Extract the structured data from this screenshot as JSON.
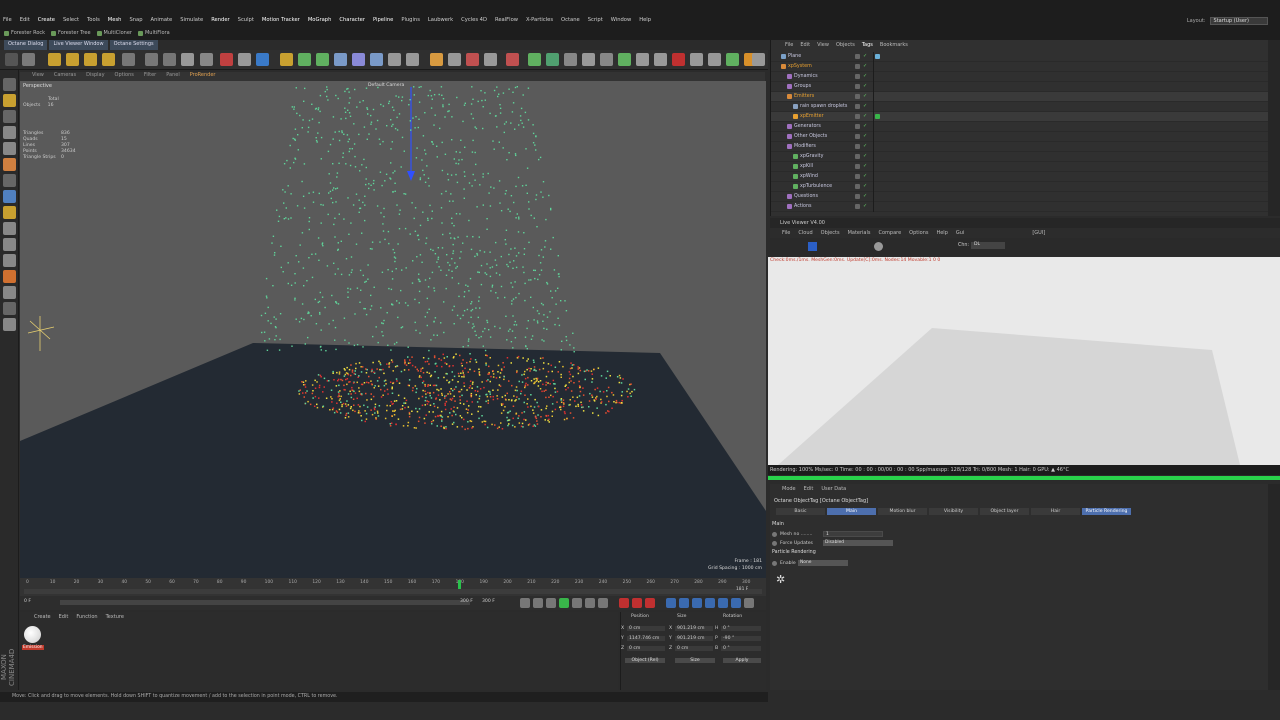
{
  "menubar": {
    "items": [
      "File",
      "Edit",
      "Create",
      "Select",
      "Tools",
      "Mesh",
      "Snap",
      "Animate",
      "Simulate",
      "Render",
      "Sculpt",
      "Motion Tracker",
      "MoGraph",
      "Character",
      "Pipeline",
      "Plugins",
      "Laubwerk",
      "Cycles 4D",
      "RealFlow",
      "X-Particles",
      "Octane",
      "Script",
      "Window",
      "Help"
    ],
    "layout_label": "Layout:",
    "layout_value": "Startup (User)"
  },
  "plugbar": {
    "items": [
      "Forester Rock",
      "Forester Tree",
      "MultiCloner",
      "MultiFlora"
    ]
  },
  "tabs": {
    "items": [
      "Octane Dialog",
      "Live Viewer Window",
      "Octane Settings"
    ]
  },
  "viewport": {
    "menu": [
      "View",
      "Cameras",
      "Display",
      "Options",
      "Filter",
      "Panel",
      "ProRender"
    ],
    "label": "Perspective",
    "camera_label": "Default Camera",
    "stats_header": "Total",
    "stats_objects_label": "Objects",
    "stats_objects_value": "16",
    "stats": [
      {
        "label": "Triangles",
        "value": "836"
      },
      {
        "label": "Quads",
        "value": "15"
      },
      {
        "label": "Lines",
        "value": "307"
      },
      {
        "label": "Points",
        "value": "34634"
      },
      {
        "label": "Triangle Strips",
        "value": "0"
      }
    ],
    "frame_text": "Frame : 181",
    "grid_text": "Grid Spacing : 1000 cm"
  },
  "timeline": {
    "ticks": [
      "0",
      "10",
      "20",
      "30",
      "40",
      "50",
      "60",
      "70",
      "80",
      "90",
      "100",
      "110",
      "120",
      "130",
      "140",
      "150",
      "160",
      "170",
      "180",
      "190",
      "200",
      "210",
      "220",
      "230",
      "240",
      "250",
      "260",
      "270",
      "280",
      "290",
      "300"
    ],
    "current_frame": 181,
    "max_frame": 300,
    "start_field": "0 F",
    "end_field": "300 F",
    "mid_field": "300 F",
    "right_field": "181 F"
  },
  "materials": {
    "menu": [
      "Create",
      "Edit",
      "Function",
      "Texture"
    ],
    "swatch_label": "Emission"
  },
  "coords": {
    "headers": [
      "Position",
      "Size",
      "Rotation"
    ],
    "rows": [
      {
        "axis": "X",
        "pos": "0 cm",
        "size_axis": "X",
        "size": "901.219 cm",
        "rot_axis": "H",
        "rot": "0 °"
      },
      {
        "axis": "Y",
        "pos": "1147.746 cm",
        "size_axis": "Y",
        "size": "901.219 cm",
        "rot_axis": "P",
        "rot": "-90 °"
      },
      {
        "axis": "Z",
        "pos": "0 cm",
        "size_axis": "Z",
        "size": "0 cm",
        "rot_axis": "B",
        "rot": "0 °"
      }
    ],
    "mode_select": "Object (Rel)",
    "size_select": "Size",
    "apply_label": "Apply"
  },
  "statusbar": {
    "text": "Move: Click and drag to move elements. Hold down SHIFT to quantize movement / add to the selection in point mode, CTRL to remove."
  },
  "maxon_text": "MAXON CINEMA4D",
  "object_manager": {
    "menu": [
      "File",
      "Edit",
      "View",
      "Objects",
      "Tags",
      "Bookmarks"
    ],
    "objects": [
      {
        "name": "Plane",
        "indent": 0,
        "color": "#7aa0c8"
      },
      {
        "name": "xpSystem",
        "indent": 0,
        "color": "#d88a3a"
      },
      {
        "name": "Dynamics",
        "indent": 1,
        "color": "#a070c0"
      },
      {
        "name": "Groups",
        "indent": 1,
        "color": "#a070c0"
      },
      {
        "name": "Emitters",
        "indent": 1,
        "color": "#d88a3a"
      },
      {
        "name": "rain spawn droplets",
        "indent": 2,
        "color": "#88a0c0"
      },
      {
        "name": "xpEmitter",
        "indent": 2,
        "color": "#e8a030"
      },
      {
        "name": "Generators",
        "indent": 1,
        "color": "#a070c0"
      },
      {
        "name": "Other Objects",
        "indent": 1,
        "color": "#a070c0"
      },
      {
        "name": "Modifiers",
        "indent": 1,
        "color": "#a070c0"
      },
      {
        "name": "xpGravity",
        "indent": 2,
        "color": "#60b060"
      },
      {
        "name": "xpKill",
        "indent": 2,
        "color": "#60b060"
      },
      {
        "name": "xpWind",
        "indent": 2,
        "color": "#60b060"
      },
      {
        "name": "xpTurbulence",
        "indent": 2,
        "color": "#60b060"
      },
      {
        "name": "Questions",
        "indent": 1,
        "color": "#a070c0"
      },
      {
        "name": "Actions",
        "indent": 1,
        "color": "#a070c0"
      }
    ]
  },
  "live_viewer": {
    "title": "Live Viewer V4.00",
    "menu": [
      "File",
      "Cloud",
      "Objects",
      "Materials",
      "Compare",
      "Options",
      "Help",
      "Gui"
    ],
    "gui_badge": "[GUI]",
    "channel_label": "Chn:",
    "channel_value": "DL",
    "check_text": "Check:0ms./1ms. MeshGen:0ms. Update[C]:0ms. Nodes:14 Movable:1  0 0",
    "status": "Rendering: 100%  Ms/sec: 0    Time: 00 : 00 : 00/00 : 00 : 00  Spp/maxspp: 128/128    Tri: 0/800     Mesh: 1  Hair: 0       GPU:  ▲   46°C",
    "progress": 1.0,
    "progress_color": "#29d24b"
  },
  "attributes": {
    "menu": [
      "Mode",
      "Edit",
      "User Data"
    ],
    "title": "Octane ObjectTag [Octane ObjectTag]",
    "tabs": [
      "Basic",
      "Main",
      "Motion blur",
      "Visibility",
      "Object layer",
      "Hair",
      "Particle Rendering"
    ],
    "active_tabs": [
      "Main",
      "Particle Rendering"
    ],
    "section_main": "Main",
    "mesh_label": "Mesh no ........",
    "mesh_value": "1",
    "force_label": "Force Updates",
    "force_value": "Disabled",
    "section_particle": "Particle Rendering",
    "enable_label": "Enable",
    "enable_value": "None"
  }
}
